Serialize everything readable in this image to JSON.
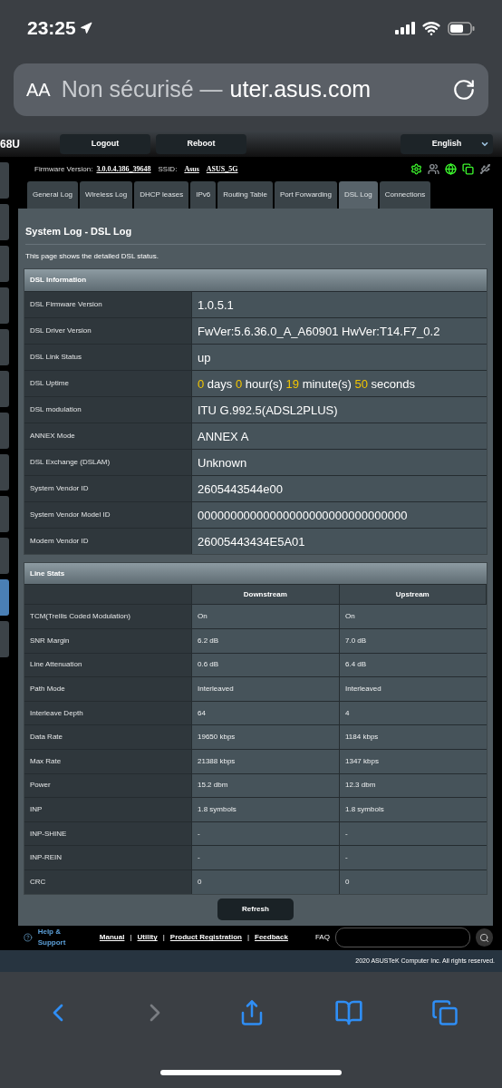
{
  "status_bar": {
    "time": "23:25"
  },
  "address_bar": {
    "text_size_button": "AA",
    "security": "Non sécurisé —",
    "url": "uter.asus.com"
  },
  "router": {
    "model": "68U",
    "buttons": [
      "Logout",
      "Reboot"
    ],
    "language": "English",
    "firmware": {
      "label": "Firmware Version:",
      "value": "3.0.0.4.386_39648"
    },
    "ssid": {
      "label": "SSID:",
      "values": [
        "Asus",
        "ASUS_5G"
      ]
    },
    "status_icons": [
      {
        "kind": "gear",
        "on": true
      },
      {
        "kind": "people",
        "on": false
      },
      {
        "kind": "globe",
        "on": true
      },
      {
        "kind": "monitor",
        "on": true
      },
      {
        "kind": "usb",
        "on": false
      }
    ],
    "sidebar": {
      "items": [
        {
          "selected": false
        },
        {
          "selected": false
        },
        {
          "selected": false
        },
        {
          "selected": false
        },
        {
          "selected": false
        },
        {
          "selected": false
        },
        {
          "selected": false
        },
        {
          "selected": false
        },
        {
          "selected": false
        },
        {
          "selected": false
        },
        {
          "selected": true
        },
        {
          "selected": false
        }
      ]
    },
    "tabs": [
      {
        "label": "General Log",
        "selected": false
      },
      {
        "label": "Wireless Log",
        "selected": false
      },
      {
        "label": "DHCP leases",
        "selected": false
      },
      {
        "label": "IPv6",
        "selected": false
      },
      {
        "label": "Routing Table",
        "selected": false
      },
      {
        "label": "Port Forwarding",
        "selected": false
      },
      {
        "label": "DSL Log",
        "selected": true
      },
      {
        "label": "Connections",
        "selected": false
      }
    ],
    "title": "System Log - DSL Log",
    "description": "This page shows the detailed DSL status.",
    "dsl_information": {
      "heading": "DSL Information",
      "rows": [
        {
          "label": "DSL Firmware Version",
          "value": [
            {
              "kind": "text",
              "text": "1.0.5.1"
            }
          ]
        },
        {
          "label": "DSL Driver Version",
          "value": [
            {
              "kind": "text",
              "text": "FwVer:5.6.36.0_A_A60901 HwVer:T14.F7_0.2"
            }
          ]
        },
        {
          "label": "DSL Link Status",
          "value": [
            {
              "kind": "text",
              "text": "up"
            }
          ]
        },
        {
          "label": "DSL Uptime",
          "value": [
            {
              "kind": "number",
              "text": "0"
            },
            {
              "kind": "text",
              "text": "days"
            },
            {
              "kind": "number",
              "text": "0"
            },
            {
              "kind": "text",
              "text": "hour(s)"
            },
            {
              "kind": "number",
              "text": "19"
            },
            {
              "kind": "text",
              "text": "minute(s)"
            },
            {
              "kind": "number",
              "text": "50"
            },
            {
              "kind": "text",
              "text": "seconds"
            }
          ]
        },
        {
          "label": "DSL modulation",
          "value": [
            {
              "kind": "text",
              "text": "ITU G.992.5(ADSL2PLUS)"
            }
          ]
        },
        {
          "label": "ANNEX Mode",
          "value": [
            {
              "kind": "text",
              "text": "ANNEX A"
            }
          ]
        },
        {
          "label": "DSL Exchange (DSLAM)",
          "value": [
            {
              "kind": "text",
              "text": "Unknown"
            }
          ]
        },
        {
          "label": "System Vendor ID",
          "value": [
            {
              "kind": "text",
              "text": "2605443544e00"
            }
          ]
        },
        {
          "label": "System Vendor Model ID",
          "value": [
            {
              "kind": "text",
              "text": "00000000000000000000000000000000"
            }
          ]
        },
        {
          "label": "Modem Vendor ID",
          "value": [
            {
              "kind": "text",
              "text": "26005443434E5A01"
            }
          ]
        }
      ]
    },
    "line_stats": {
      "heading": "Line Stats",
      "columns": [
        "Downstream",
        "Upstream"
      ],
      "rows": [
        {
          "label": "TCM(Trellis Coded Modulation)",
          "downstream": "On",
          "upstream": "On"
        },
        {
          "label": "SNR Margin",
          "downstream": "6.2 dB",
          "upstream": "7.0 dB"
        },
        {
          "label": "Line Attenuation",
          "downstream": "0.6 dB",
          "upstream": "6.4 dB"
        },
        {
          "label": "Path Mode",
          "downstream": "Interleaved",
          "upstream": "Interleaved"
        },
        {
          "label": "Interleave Depth",
          "downstream": "64",
          "upstream": "4"
        },
        {
          "label": "Data Rate",
          "downstream": "19650 kbps",
          "upstream": "1184 kbps"
        },
        {
          "label": "Max Rate",
          "downstream": "21388 kbps",
          "upstream": "1347 kbps"
        },
        {
          "label": "Power",
          "downstream": "15.2 dbm",
          "upstream": "12.3 dbm"
        },
        {
          "label": "INP",
          "downstream": "1.8 symbols",
          "upstream": "1.8 symbols"
        },
        {
          "label": "INP-SHINE",
          "downstream": "-",
          "upstream": "-"
        },
        {
          "label": "INP-REIN",
          "downstream": "-",
          "upstream": "-"
        },
        {
          "label": "CRC",
          "downstream": "0",
          "upstream": "0"
        }
      ]
    },
    "refresh_button": "Refresh",
    "footer": {
      "help": "Help & Support",
      "links": [
        "Manual",
        "Utility",
        "Product Registration",
        "Feedback"
      ],
      "separator": "|",
      "faq_label": "FAQ"
    },
    "copyright": "2020 ASUSTeK Computer Inc. All rights reserved."
  },
  "toolbar": {
    "back_enabled": true,
    "forward_enabled": false
  }
}
